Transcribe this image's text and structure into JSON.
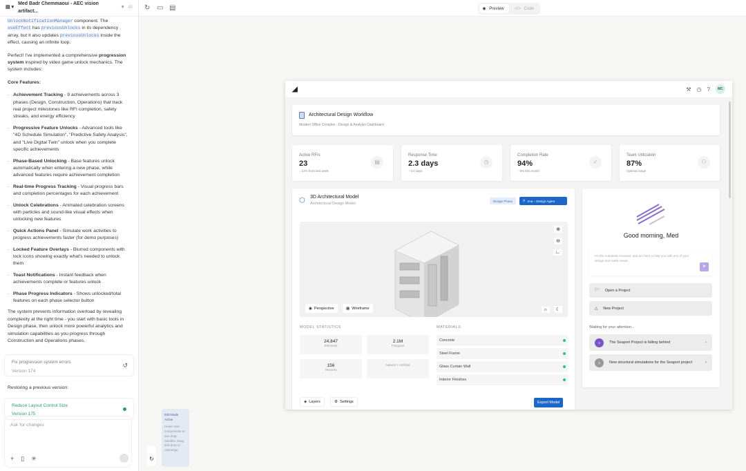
{
  "header": {
    "title": "Med Badr Chemmaoui - AEC vision artifact...",
    "badge": "AI"
  },
  "chat": {
    "intro_code1": "UnlockNotificationManager",
    "intro_a": " component. The ",
    "intro_code2": "useEffect",
    "intro_b": " has ",
    "intro_code3": "previousUnlocks",
    "intro_c": " in its dependency array, but it also updates ",
    "intro_code4": "previousUnlocks",
    "intro_d": " inside the effect, causing an infinite loop.",
    "p1a": "Perfect! I've implemented a comprehensive ",
    "p1b": "progression system",
    "p1c": " inspired by video game unlock mechanics. The system includes:",
    "core": "Core Features:",
    "features": [
      {
        "t": "Achievement Tracking",
        "d": " - 9 achievements across 3 phases (Design, Construction, Operations) that track real project milestones like RFI completion, safety streaks, and energy efficiency"
      },
      {
        "t": "Progressive Feature Unlocks",
        "d": " - Advanced tools like \"4D Schedule Simulation\", \"Predictive Safety Analysis\", and \"Live Digital Twin\" unlock when you complete specific achievements"
      },
      {
        "t": "Phase-Based Unlocking",
        "d": " - Base features unlock automatically when entering a new phase, while advanced features require achievement completion"
      },
      {
        "t": "Real-time Progress Tracking",
        "d": " - Visual progress bars and completion percentages for each achievement"
      },
      {
        "t": "Unlock Celebrations",
        "d": " - Animated celebration screens with particles and sound-like visual effects when unlocking new features"
      },
      {
        "t": "Quick Actions Panel",
        "d": " - Simulate work activities to progress achievements faster (for demo purposes)"
      },
      {
        "t": "Locked Feature Overlays",
        "d": " - Blurred components with lock icons showing exactly what's needed to unlock them"
      },
      {
        "t": "Toast Notifications",
        "d": " - Instant feedback when achievements complete or features unlock"
      },
      {
        "t": "Phase Progress Indicators",
        "d": " - Shows unlocked/total features on each phase selector button"
      }
    ],
    "outro": "The system prevents information overload by revealing complexity at the right time - you start with basic tools in Design phase, then unlock more powerful analytics and simulation capabilities as you progress through Construction and Operations phases.",
    "version1": {
      "title": "Fix progression system errors",
      "version": "Version 174"
    },
    "restoring": "Restoring a previous version:",
    "version2": {
      "title": "Reduce Layout Control Size",
      "version": "Version 175"
    },
    "input_placeholder": "Ask for changes"
  },
  "toolbar": {
    "preview": "Preview",
    "code": "Code"
  },
  "tooltip": {
    "title": "Edit Mode Active",
    "body": "Hover over components to see drag handles. Drag and drop to rearrange."
  },
  "app": {
    "avatar": "MC",
    "project": {
      "title": "Architectural Design Workflow",
      "subtitle": "Modern Office Complex - Design & Analysis Dashboard"
    },
    "kpis": [
      {
        "label": "Active RFIs",
        "value": "23",
        "sub": "↓ 12% from last week"
      },
      {
        "label": "Response Time",
        "value": "2.3 days",
        "sub": "↑ 0.5 days"
      },
      {
        "label": "Completion Rate",
        "value": "94%",
        "sub": "↑ 6% this month"
      },
      {
        "label": "Team Utilization",
        "value": "87%",
        "sub": "Optimal range"
      }
    ],
    "model": {
      "title": "3D Architectural Model",
      "subtitle": "Architectural Design Model",
      "phase": "Design Phase",
      "agent": "Ana – Design Agent",
      "perspective": "Perspective",
      "wireframe": "Wireframe",
      "stats_title": "MODEL STATISTICS",
      "stats": [
        {
          "n": "24,847",
          "c": "Elements"
        },
        {
          "n": "2.1M",
          "c": "Polygons"
        },
        {
          "n": "156",
          "c": "Textures"
        },
        {
          "n": "",
          "c": "Natural + Artificial"
        }
      ],
      "materials_title": "MATERIALS",
      "materials": [
        "Concrete",
        "Steel Frame",
        "Glass Curtain Wall",
        "Interior Finishes"
      ],
      "layers": "Layers",
      "settings": "Settings",
      "export": "Export Model"
    },
    "assistant": {
      "greeting": "Good morning, Med",
      "placeholder": "I'm the Autodesk Assistant, and am here to help you with any of your design and make needs.",
      "open": "Open a Project",
      "new": "New Project",
      "waiting": "Waiting for your attention...",
      "items": [
        {
          "n": "1",
          "t": "The Seaport Project is falling behind"
        },
        {
          "n": "2",
          "t": "New structural simulations for the Seaport project"
        }
      ]
    }
  }
}
